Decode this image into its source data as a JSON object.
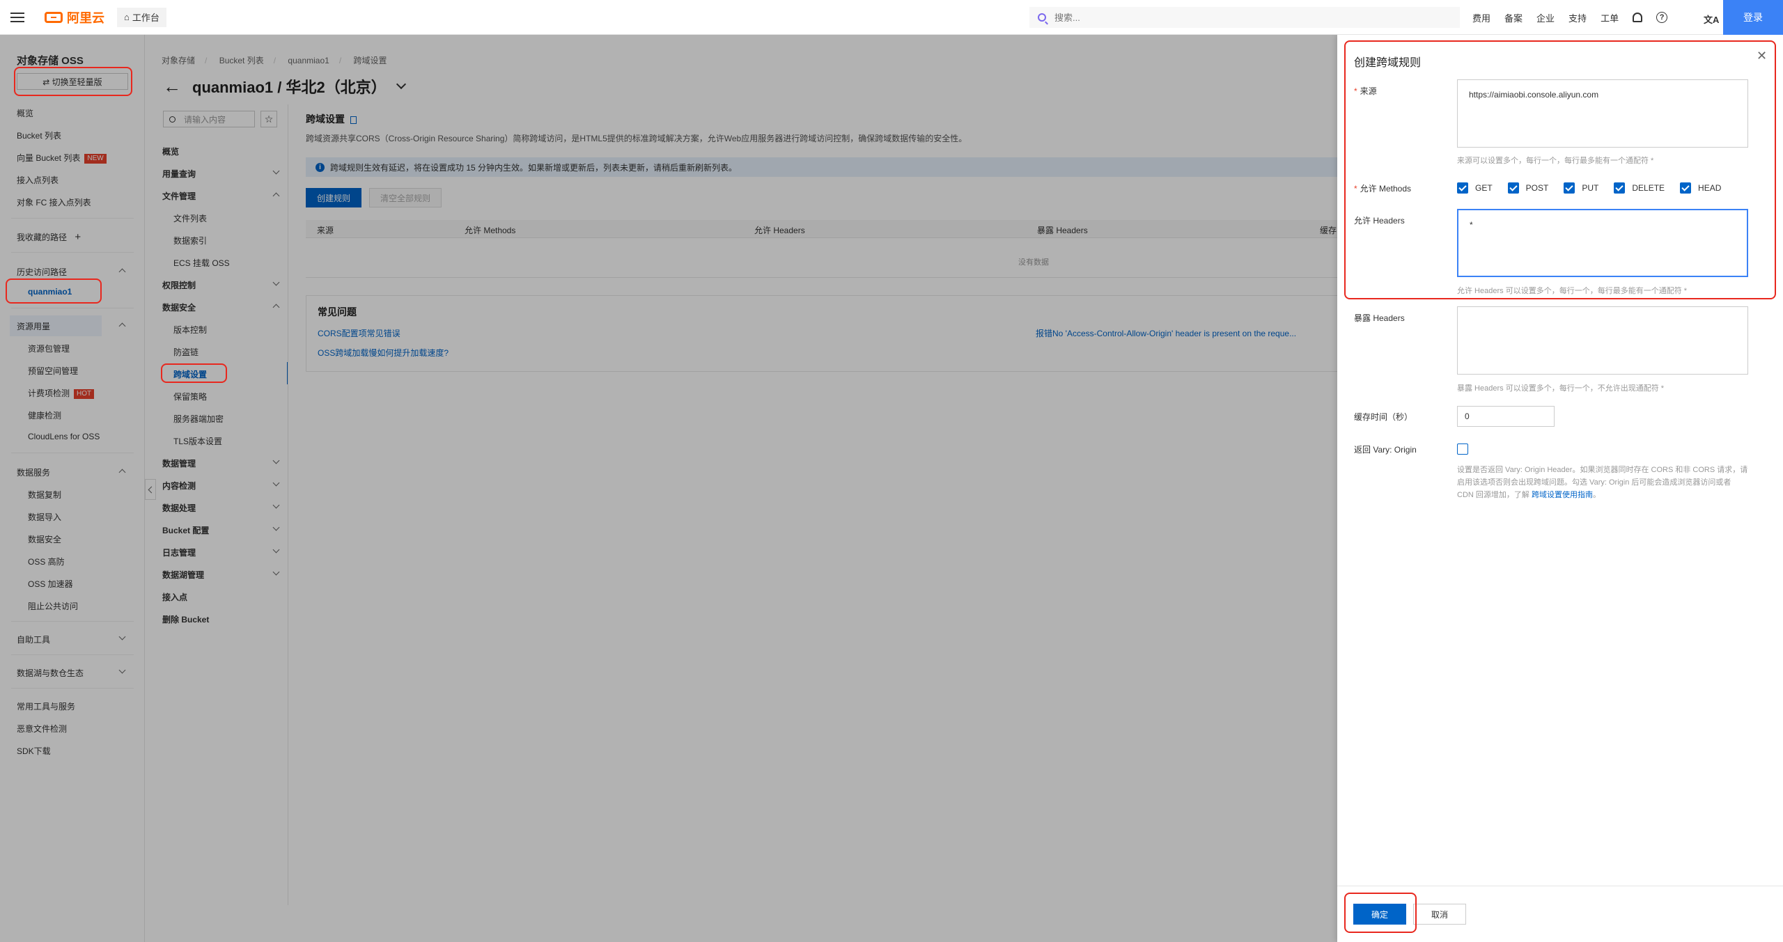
{
  "topbar": {
    "logo": "阿里云",
    "workbench": "工作台",
    "search_placeholder": "搜索...",
    "links": [
      "费用",
      "备案",
      "企业",
      "支持",
      "工单"
    ],
    "translate": "文A",
    "login": "登录"
  },
  "sidebar": {
    "title": "对象存储 OSS",
    "switch_button": "⇄ 切换至轻量版",
    "items": {
      "overview": "概览",
      "bucket_list": "Bucket 列表",
      "vector_bucket": "向量 Bucket 列表",
      "vector_bucket_tag": "NEW",
      "access_points": "接入点列表",
      "fc_access_points": "对象 FC 接入点列表",
      "favorites": "我收藏的路径",
      "history": "历史访问路径",
      "history_active": "quanmiao1",
      "resources": "资源用量",
      "resource_pack": "资源包管理",
      "reserved_space": "预留空间管理",
      "billing_check": "计费项检测",
      "billing_check_tag": "HOT",
      "health_check": "健康检测",
      "cloudlens": "CloudLens for OSS",
      "data_services": "数据服务",
      "data_replication": "数据复制",
      "data_import": "数据导入",
      "data_security": "数据安全",
      "oss_ddos": "OSS 高防",
      "oss_accelerator": "OSS 加速器",
      "block_public": "阻止公共访问",
      "self_tools": "自助工具",
      "data_lake": "数据湖与数仓生态",
      "common_tools": "常用工具与服务",
      "malware_check": "恶意文件检测",
      "sdk_download": "SDK下载"
    }
  },
  "breadcrumb": [
    "对象存储",
    "Bucket 列表",
    "quanmiao1",
    "跨域设置"
  ],
  "bucket_title": "quanmiao1 / 华北2（北京）",
  "subnav": {
    "search_placeholder": "请输入内容",
    "items": {
      "overview": "概览",
      "usage": "用量查询",
      "file_mgmt": "文件管理",
      "file_list": "文件列表",
      "data_index": "数据索引",
      "ecs_mount": "ECS 挂载 OSS",
      "access_control": "权限控制",
      "data_security": "数据安全",
      "versioning": "版本控制",
      "hotlink": "防盗链",
      "cors": "跨域设置",
      "retention": "保留策略",
      "server_encryption": "服务器端加密",
      "tls": "TLS版本设置",
      "data_mgmt": "数据管理",
      "content_detect": "内容检测",
      "data_processing": "数据处理",
      "bucket_config": "Bucket 配置",
      "log_mgmt": "日志管理",
      "data_lake_mgmt": "数据湖管理",
      "access_point": "接入点",
      "delete_bucket": "删除 Bucket"
    }
  },
  "main": {
    "title": "跨域设置",
    "description": "跨域资源共享CORS（Cross-Origin Resource Sharing）简称跨域访问，是HTML5提供的标准跨域解决方案，允许Web应用服务器进行跨域访问控制，确保跨域数据传输的安全性。",
    "info": "跨域规则生效有延迟，将在设置成功 15 分钟内生效。如果新增或更新后，列表未更新，请稍后重新刷新列表。",
    "create_button": "创建规则",
    "clear_button": "清空全部规则",
    "table_headers": [
      "来源",
      "允许 Methods",
      "允许 Headers",
      "暴露 Headers",
      "缓存"
    ],
    "no_data": "没有数据",
    "faq_title": "常见问题",
    "faq_links": [
      "CORS配置项常见错误",
      "报错No 'Access-Control-Allow-Origin' header is present on the reque...",
      "OSS跨域加载慢如何提升加载速度?"
    ]
  },
  "drawer": {
    "title": "创建跨域规则",
    "close": "✕",
    "origin_label": "来源",
    "origin_value": "https://aimiaobi.console.aliyun.com",
    "origin_hint": "来源可以设置多个，每行一个，每行最多能有一个通配符 *",
    "methods_label": "允许 Methods",
    "methods": [
      "GET",
      "POST",
      "PUT",
      "DELETE",
      "HEAD"
    ],
    "allow_headers_label": "允许 Headers",
    "allow_headers_value": "*",
    "allow_headers_hint": "允许 Headers 可以设置多个，每行一个，每行最多能有一个通配符 *",
    "expose_headers_label": "暴露 Headers",
    "expose_headers_value": "",
    "expose_headers_hint": "暴露 Headers 可以设置多个，每行一个，不允许出现通配符 *",
    "cache_label": "缓存时间（秒）",
    "cache_value": "0",
    "vary_label": "返回 Vary: Origin",
    "vary_desc": "设置是否返回 Vary: Origin Header。如果浏览器同时存在 CORS 和非 CORS 请求，请启用该选项否则会出现跨域问题。勾选 Vary: Origin 后可能会造成浏览器访问或者 CDN 回源增加，了解",
    "vary_link": "跨域设置使用指南",
    "vary_end": "。",
    "ok": "确定",
    "cancel": "取消"
  },
  "colors": {
    "primary": "#0064c8",
    "brand": "#ff6a00",
    "highlight": "#e8281e",
    "login": "#3b82f6"
  }
}
